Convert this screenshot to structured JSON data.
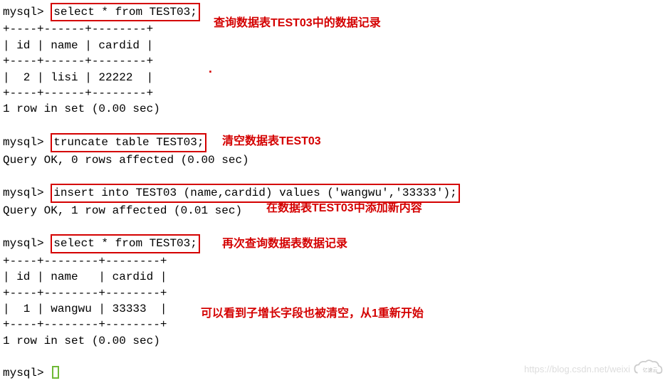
{
  "prompt": "mysql>",
  "cmd1": "select * from TEST03;",
  "cmd2": "truncate table TEST03;",
  "cmd3": "insert into TEST03 (name,cardid) values ('wangwu','33333');",
  "cmd4": "select * from TEST03;",
  "sep1": "+----+------+--------+",
  "hdr1": "| id | name | cardid |",
  "row1": "|  2 | lisi | 22222  |",
  "res1": "1 row in set (0.00 sec)",
  "res2": "Query OK, 0 rows affected (0.00 sec)",
  "res3": "Query OK, 1 row affected (0.01 sec)",
  "sep2": "+----+--------+--------+",
  "hdr2": "| id | name   | cardid |",
  "row2": "|  1 | wangwu | 33333  |",
  "res4": "1 row in set (0.00 sec)",
  "ann1": "查询数据表TEST03中的数据记录",
  "ann2": "清空数据表TEST03",
  "ann3": "在数据表TEST03中添加新内容",
  "ann4": "再次查询数据表数据记录",
  "ann5": "可以看到子增长字段也被清空，从1重新开始",
  "watermark": "https://blog.csdn.net/weixi",
  "logo_text": "亿速云"
}
